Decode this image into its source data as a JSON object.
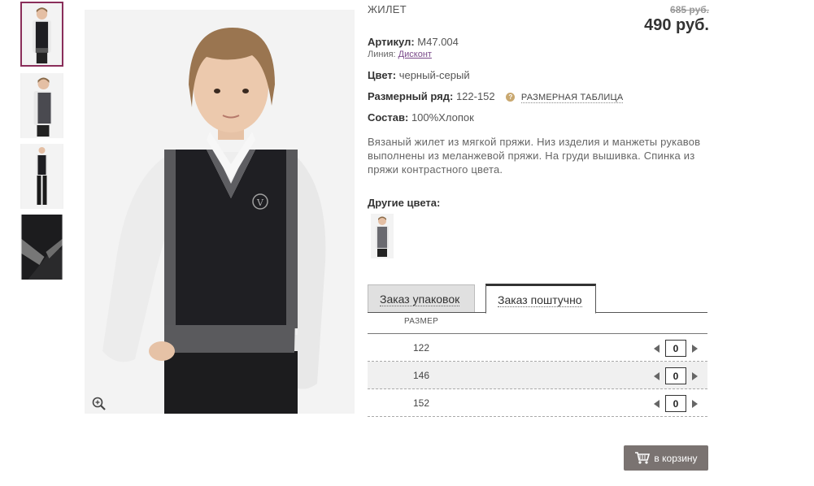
{
  "product": {
    "name": "ЖИЛЕТ",
    "old_price": "685 руб.",
    "price": "490 руб.",
    "article_label": "Артикул:",
    "article_value": "M47.004",
    "line_label": "Линия:",
    "line_value": "Дисконт",
    "color_label": "Цвет:",
    "color_value": "черный-серый",
    "sizes_label": "Размерный ряд:",
    "sizes_value": "122-152",
    "size_table_link": "РАЗМЕРНАЯ ТАБЛИЦА",
    "composition_label": "Состав:",
    "composition_value": "100%Хлопок",
    "description": "Вязаный жилет из мягкой пряжи. Низ изделия и манжеты рукавов выполнены из меланжевой пряжи. На груди вышивка. Спинка из пряжи контрастного цвета."
  },
  "other_colors_label": "Другие цвета:",
  "tabs": [
    {
      "label": "Заказ упаковок",
      "active": false
    },
    {
      "label": "Заказ поштучно",
      "active": true
    }
  ],
  "size_table": {
    "header": "РАЗМЕР",
    "rows": [
      {
        "size": "122",
        "qty": "0"
      },
      {
        "size": "146",
        "qty": "0"
      },
      {
        "size": "152",
        "qty": "0"
      }
    ]
  },
  "cart_button": "в корзину",
  "icons": {
    "zoom": "zoom-in-icon",
    "help": "question-icon",
    "cart": "cart-icon",
    "decrease": "arrow-left-icon",
    "increase": "arrow-right-icon"
  },
  "colors": {
    "thumb_active_border": "#8a2e5a",
    "cart_button_bg": "#7a7371",
    "help_icon": "#c9a870",
    "link": "#7a4a8a"
  }
}
